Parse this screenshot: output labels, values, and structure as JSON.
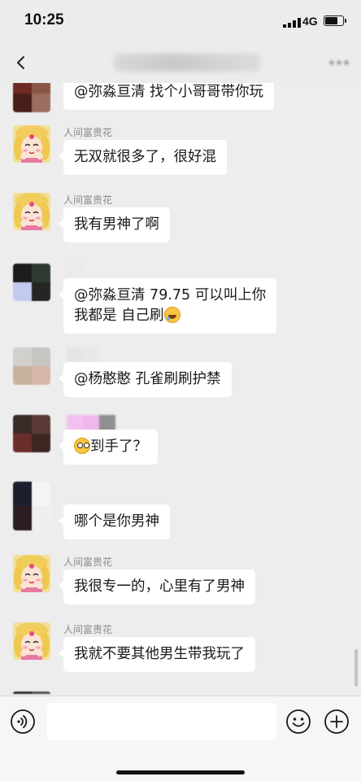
{
  "status_bar": {
    "time": "10:25",
    "network": "4G"
  },
  "nav": {
    "back_icon": "chevron-left-icon",
    "more_icon": "ellipsis-icon"
  },
  "messages": [
    {
      "sender": "",
      "text_lines": [
        "@弥淼亘清 找个小哥哥带你玩"
      ],
      "avatar": "mosaic-1"
    },
    {
      "sender": "人间富贵花",
      "text_lines": [
        "无双就很多了，很好混"
      ],
      "avatar": "sailor-moon"
    },
    {
      "sender": "人间富贵花",
      "text_lines": [
        "我有男神了啊"
      ],
      "avatar": "sailor-moon"
    },
    {
      "sender": "",
      "text_lines": [
        "@弥淼亘清 79.75 可以叫上你",
        "我都是 自己刷"
      ],
      "trailing_emoji": "laughing-tears-emoji",
      "avatar": "mosaic-2"
    },
    {
      "sender": "",
      "text_lines": [
        "@杨憨憨 孔雀刷刷护禁"
      ],
      "avatar": "mosaic-3"
    },
    {
      "sender": "",
      "text_lines": [
        "到手了？"
      ],
      "leading_emoji": "staring-eyes-emoji",
      "avatar": "mosaic-4"
    },
    {
      "sender": "",
      "text_lines": [
        "哪个是你男神"
      ],
      "avatar": "mosaic-5"
    },
    {
      "sender": "人间富贵花",
      "text_lines": [
        "我很专一的，心里有了男神"
      ],
      "avatar": "sailor-moon"
    },
    {
      "sender": "人间富贵花",
      "text_lines": [
        "我就不要其他男生带我玩了"
      ],
      "avatar": "sailor-moon"
    }
  ],
  "input_bar": {
    "voice_icon": "voice-icon",
    "emoji_icon": "smiley-icon",
    "plus_icon": "plus-circle-icon",
    "text_value": ""
  }
}
